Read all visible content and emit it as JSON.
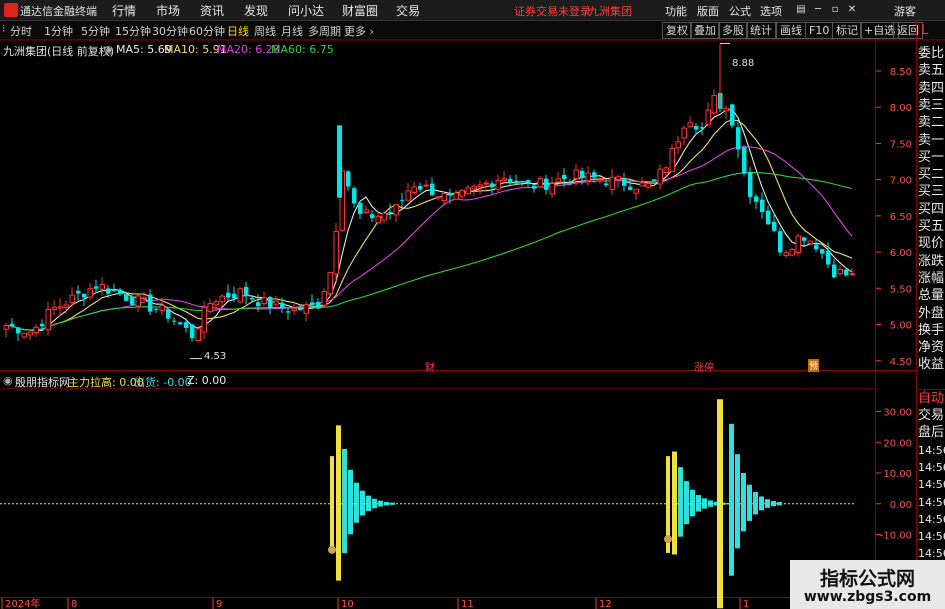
{
  "title_bar": {
    "app_name": "通达信金融终端",
    "menus": [
      "行情",
      "市场",
      "资讯",
      "发现",
      "问小达",
      "财富圈",
      "交易"
    ],
    "warning": "证券交易未登录",
    "stock": "九洲集团",
    "right_menus": [
      "功能",
      "版面",
      "公式",
      "选项"
    ],
    "guest": "游客"
  },
  "toolbar": {
    "periods": [
      "分时",
      "1分钟",
      "5分钟",
      "15分钟",
      "30分钟",
      "60分钟",
      "日线",
      "周线",
      "月线",
      "多周期",
      "更多 ›"
    ],
    "active_period": "日线",
    "right_buttons": [
      "复权",
      "叠加",
      "多股",
      "统计",
      "画线",
      "F10",
      "标记",
      "+自选",
      "返回"
    ]
  },
  "main_chart": {
    "header": "九洲集团(日线 前复权)",
    "ma": [
      {
        "label": "MA5:",
        "value": "5.69",
        "color": "#e8e8e8"
      },
      {
        "label": "MA10:",
        "value": "5.91",
        "color": "#f0e060"
      },
      {
        "label": "MA20:",
        "value": "6.28",
        "color": "#e040e0"
      },
      {
        "label": "MA60:",
        "value": "6.75",
        "color": "#30d030"
      }
    ],
    "high_label": "8.88",
    "low_label": "4.53",
    "markers": [
      "财",
      "涨停",
      "预"
    ],
    "y_ticks": [
      "8.50",
      "8.00",
      "7.50",
      "7.00",
      "6.50",
      "6.00",
      "5.50",
      "5.00",
      "4.50"
    ]
  },
  "indicator": {
    "name": "殷朋指标网",
    "items": [
      {
        "label": "主力拉高:",
        "value": "0.00",
        "color": "#f0e040"
      },
      {
        "label": "出货:",
        "value": "-0.00",
        "color": "#30e0e0"
      },
      {
        "label": "Z:",
        "value": "0.00",
        "color": "#e8e8e8"
      }
    ],
    "y_ticks": [
      "30.00",
      "20.00",
      "10.00",
      "0.00",
      "-10.00",
      "-20.00"
    ]
  },
  "x_axis": [
    "2024年",
    "8",
    "9",
    "10",
    "11",
    "12",
    "1"
  ],
  "sidebar": {
    "top": "L",
    "items": [
      "委比",
      "卖五",
      "卖四",
      "卖三",
      "卖二",
      "卖一",
      "买一",
      "买二",
      "买三",
      "买四",
      "买五",
      "现价",
      "涨跌",
      "涨幅",
      "总量",
      "外盘",
      "换手",
      "净资",
      "收益"
    ],
    "bottom_label": "自动",
    "bottom_items": [
      "交易",
      "盘后",
      "14:56",
      "14:56",
      "14:56",
      "14:56",
      "14:56",
      "14:56",
      "14:56",
      "14:56"
    ]
  },
  "watermark": {
    "line1": "指标公式网",
    "line2": "www.zbgs3.com"
  },
  "colors": {
    "up": "#ff3030",
    "down": "#00e5e5",
    "frame": "#8b0000"
  },
  "chart_data": {
    "type": "candlestick",
    "title": "九洲集团(日线 前复权)",
    "ylim": [
      4.4,
      8.9
    ],
    "y_ticks": [
      4.5,
      5.0,
      5.5,
      6.0,
      6.5,
      7.0,
      7.5,
      8.0,
      8.5
    ],
    "x_labels": [
      "2024年",
      "8",
      "9",
      "10",
      "11",
      "12",
      "1"
    ],
    "last_close": 5.69,
    "high": 8.88,
    "low": 4.53
  }
}
